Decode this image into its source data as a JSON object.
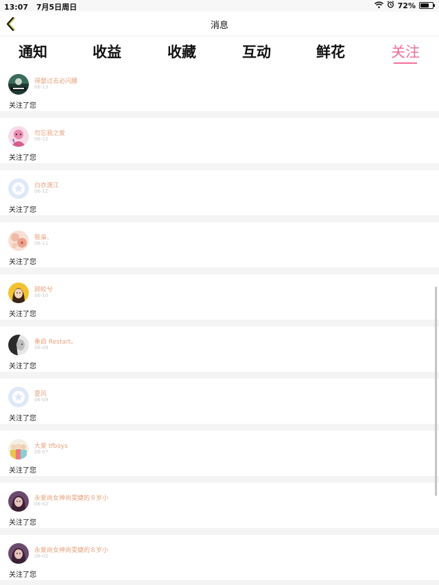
{
  "status_bar": {
    "time": "13:07",
    "date": "7月5日周日",
    "battery": "72%",
    "battery_level": 0.72
  },
  "nav": {
    "title": "消息",
    "back_icon": "chevron-left-icon"
  },
  "tabs": [
    {
      "label": "通知",
      "active": false
    },
    {
      "label": "收益",
      "active": false
    },
    {
      "label": "收藏",
      "active": false
    },
    {
      "label": "互动",
      "active": false
    },
    {
      "label": "鲜花",
      "active": false
    },
    {
      "label": "关注",
      "active": true
    }
  ],
  "colors": {
    "accent": "#ef6d9c",
    "username": "#e8a27d",
    "date": "#c8c8c8"
  },
  "notifications": [
    {
      "name": "得瑟过去必闪腰",
      "date": "06-13",
      "text": "关注了您",
      "avatar": "dark-green-avatar"
    },
    {
      "name": "勿忘我之爱",
      "date": "06-12",
      "text": "关注了您",
      "avatar": "pink-anime-avatar"
    },
    {
      "name": "白衣渡江",
      "date": "06-12",
      "text": "关注了您",
      "avatar": "default-star-avatar"
    },
    {
      "name": "筱枭、",
      "date": "06-11",
      "text": "关注了您",
      "avatar": "peach-floral-avatar"
    },
    {
      "name": "顾皎兮",
      "date": "06-10",
      "text": "关注了您",
      "avatar": "yellow-portrait-avatar"
    },
    {
      "name": "重启 Restart。",
      "date": "06-09",
      "text": "关注了您",
      "avatar": "grayscale-portrait-avatar"
    },
    {
      "name": "夏风",
      "date": "06-09",
      "text": "关注了您",
      "avatar": "default-star-avatar"
    },
    {
      "name": "大爱 tfboys",
      "date": "06-07",
      "text": "关注了您",
      "avatar": "group-photo-avatar"
    },
    {
      "name": "永爱尚女神尚雯婕的８岁小",
      "date": "06-02",
      "text": "关注了您",
      "avatar": "purple-portrait-avatar"
    },
    {
      "name": "永爱尚女神尚雯婕的８岁小",
      "date": "06-02",
      "text": "关注了您",
      "avatar": "purple-portrait-avatar"
    }
  ]
}
